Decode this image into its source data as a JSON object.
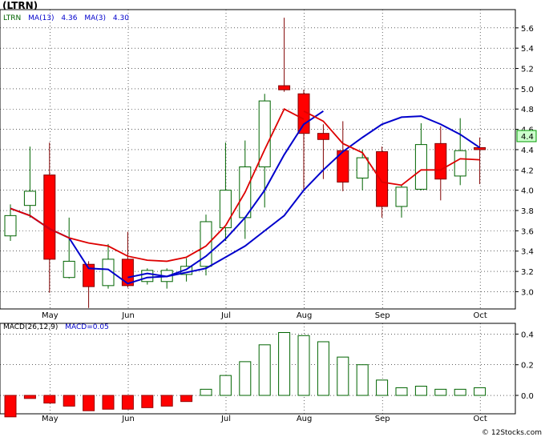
{
  "title": "(LTRN)",
  "watermark": "© 12Stocks.com",
  "colors": {
    "up_candle_fill": "#ffffff",
    "up_candle_stroke": "#006400",
    "down_candle_fill": "#ff0000",
    "down_candle_stroke": "#800000",
    "ma13": "#0000cc",
    "ma3": "#dd0000",
    "macd_bar_positive": "#006400",
    "macd_bar_negative": "#ff0000",
    "grid": "#000000",
    "price_tag_bg": "#ccffcc"
  },
  "price_legend": {
    "ticker": "LTRN",
    "ma13_label": "MA(13)",
    "ma13_value": "4.36",
    "ma3_label": "MA(3)",
    "ma3_value": "4.30"
  },
  "macd_legend": {
    "params": "MACD(26,12,9)",
    "macd_label": "MACD=0.05"
  },
  "last_price_tag": "4.4",
  "chart_data": [
    {
      "type": "candlestick",
      "title": "(LTRN)",
      "x_labels": [
        {
          "label": "May",
          "index": 1
        },
        {
          "label": "Jun",
          "index": 5
        },
        {
          "label": "Jul",
          "index": 10
        },
        {
          "label": "Aug",
          "index": 14
        },
        {
          "label": "Sep",
          "index": 18
        },
        {
          "label": "Oct",
          "index": 23
        }
      ],
      "y_ticks": [
        "3.0",
        "3.2",
        "3.4",
        "3.6",
        "3.8",
        "4.0",
        "4.2",
        "4.4",
        "4.6",
        "4.8",
        "5.0",
        "5.2",
        "5.4",
        "5.6"
      ],
      "ylim": [
        2.83,
        5.78
      ],
      "grid": true,
      "candles": [
        {
          "o": 3.55,
          "h": 3.86,
          "l": 3.5,
          "c": 3.75
        },
        {
          "o": 3.85,
          "h": 4.43,
          "l": 3.73,
          "c": 3.99
        },
        {
          "o": 4.15,
          "h": 4.47,
          "l": 2.99,
          "c": 3.32
        },
        {
          "o": 3.14,
          "h": 3.73,
          "l": 3.13,
          "c": 3.3
        },
        {
          "o": 3.27,
          "h": 3.3,
          "l": 2.84,
          "c": 3.05
        },
        {
          "o": 3.06,
          "h": 3.47,
          "l": 3.03,
          "c": 3.32
        },
        {
          "o": 3.32,
          "h": 3.59,
          "l": 3.04,
          "c": 3.06
        },
        {
          "o": 3.1,
          "h": 3.23,
          "l": 3.07,
          "c": 3.21
        },
        {
          "o": 3.1,
          "h": 3.23,
          "l": 3.03,
          "c": 3.21
        },
        {
          "o": 3.17,
          "h": 3.33,
          "l": 3.1,
          "c": 3.25
        },
        {
          "o": 3.25,
          "h": 3.76,
          "l": 3.16,
          "c": 3.69
        },
        {
          "o": 3.63,
          "h": 4.47,
          "l": 3.5,
          "c": 4.0
        },
        {
          "o": 3.73,
          "h": 4.49,
          "l": 3.52,
          "c": 4.23
        },
        {
          "o": 4.23,
          "h": 4.95,
          "l": 3.83,
          "c": 4.88
        },
        {
          "o": 5.03,
          "h": 5.7,
          "l": 4.97,
          "c": 4.99
        },
        {
          "o": 4.95,
          "h": 4.99,
          "l": 4.0,
          "c": 4.56
        },
        {
          "o": 4.56,
          "h": 4.65,
          "l": 4.11,
          "c": 4.5
        },
        {
          "o": 4.39,
          "h": 4.68,
          "l": 3.99,
          "c": 4.08
        },
        {
          "o": 4.12,
          "h": 4.4,
          "l": 4.0,
          "c": 4.32
        },
        {
          "o": 4.38,
          "h": 4.43,
          "l": 3.73,
          "c": 3.84
        },
        {
          "o": 3.84,
          "h": 4.05,
          "l": 3.73,
          "c": 4.03
        },
        {
          "o": 4.01,
          "h": 4.66,
          "l": 4.0,
          "c": 4.45
        },
        {
          "o": 4.46,
          "h": 4.63,
          "l": 3.9,
          "c": 4.11
        },
        {
          "o": 4.14,
          "h": 4.71,
          "l": 4.05,
          "c": 4.39
        },
        {
          "o": 4.42,
          "h": 4.52,
          "l": 4.06,
          "c": 4.4
        }
      ],
      "series": [
        {
          "name": "MA(13)",
          "values": [
            null,
            null,
            null,
            null,
            null,
            null,
            3.14,
            3.18,
            3.15,
            3.22,
            3.35,
            3.52,
            3.73,
            4.0,
            4.35,
            4.65,
            4.78,
            null,
            null,
            null,
            null,
            null,
            null,
            null,
            null
          ]
        },
        {
          "name": "MA(3)",
          "values": [
            3.82,
            3.75,
            3.62,
            3.53,
            3.23,
            3.22,
            3.08,
            3.14,
            3.15,
            3.19,
            3.23,
            3.34,
            3.45,
            3.6,
            3.75,
            4.0,
            4.2,
            4.38,
            4.52,
            4.65,
            4.72,
            4.73,
            4.65,
            4.55,
            4.42
          ]
        },
        {
          "name": "MA(3) tail",
          "values": [
            null,
            null,
            null,
            null,
            null,
            null,
            null,
            null,
            null,
            null,
            null,
            null,
            null,
            null,
            null,
            4.78,
            4.68,
            4.46,
            4.37,
            4.08,
            4.05,
            4.2,
            4.2,
            4.31,
            4.3
          ]
        }
      ]
    },
    {
      "type": "bar",
      "title": "MACD(26,12,9)",
      "x_labels": [
        {
          "label": "May",
          "index": 1
        },
        {
          "label": "Jun",
          "index": 5
        },
        {
          "label": "Jul",
          "index": 10
        },
        {
          "label": "Aug",
          "index": 14
        },
        {
          "label": "Sep",
          "index": 18
        },
        {
          "label": "Oct",
          "index": 23
        }
      ],
      "y_ticks": [
        "0.0",
        "0.2",
        "0.4"
      ],
      "ylim": [
        -0.12,
        0.47
      ],
      "grid": true,
      "values": [
        -0.14,
        -0.02,
        -0.05,
        -0.07,
        -0.1,
        -0.09,
        -0.09,
        -0.08,
        -0.07,
        -0.04,
        0.04,
        0.13,
        0.22,
        0.33,
        0.41,
        0.39,
        0.35,
        0.25,
        0.2,
        0.1,
        0.05,
        0.06,
        0.04,
        0.04,
        0.05
      ]
    }
  ]
}
